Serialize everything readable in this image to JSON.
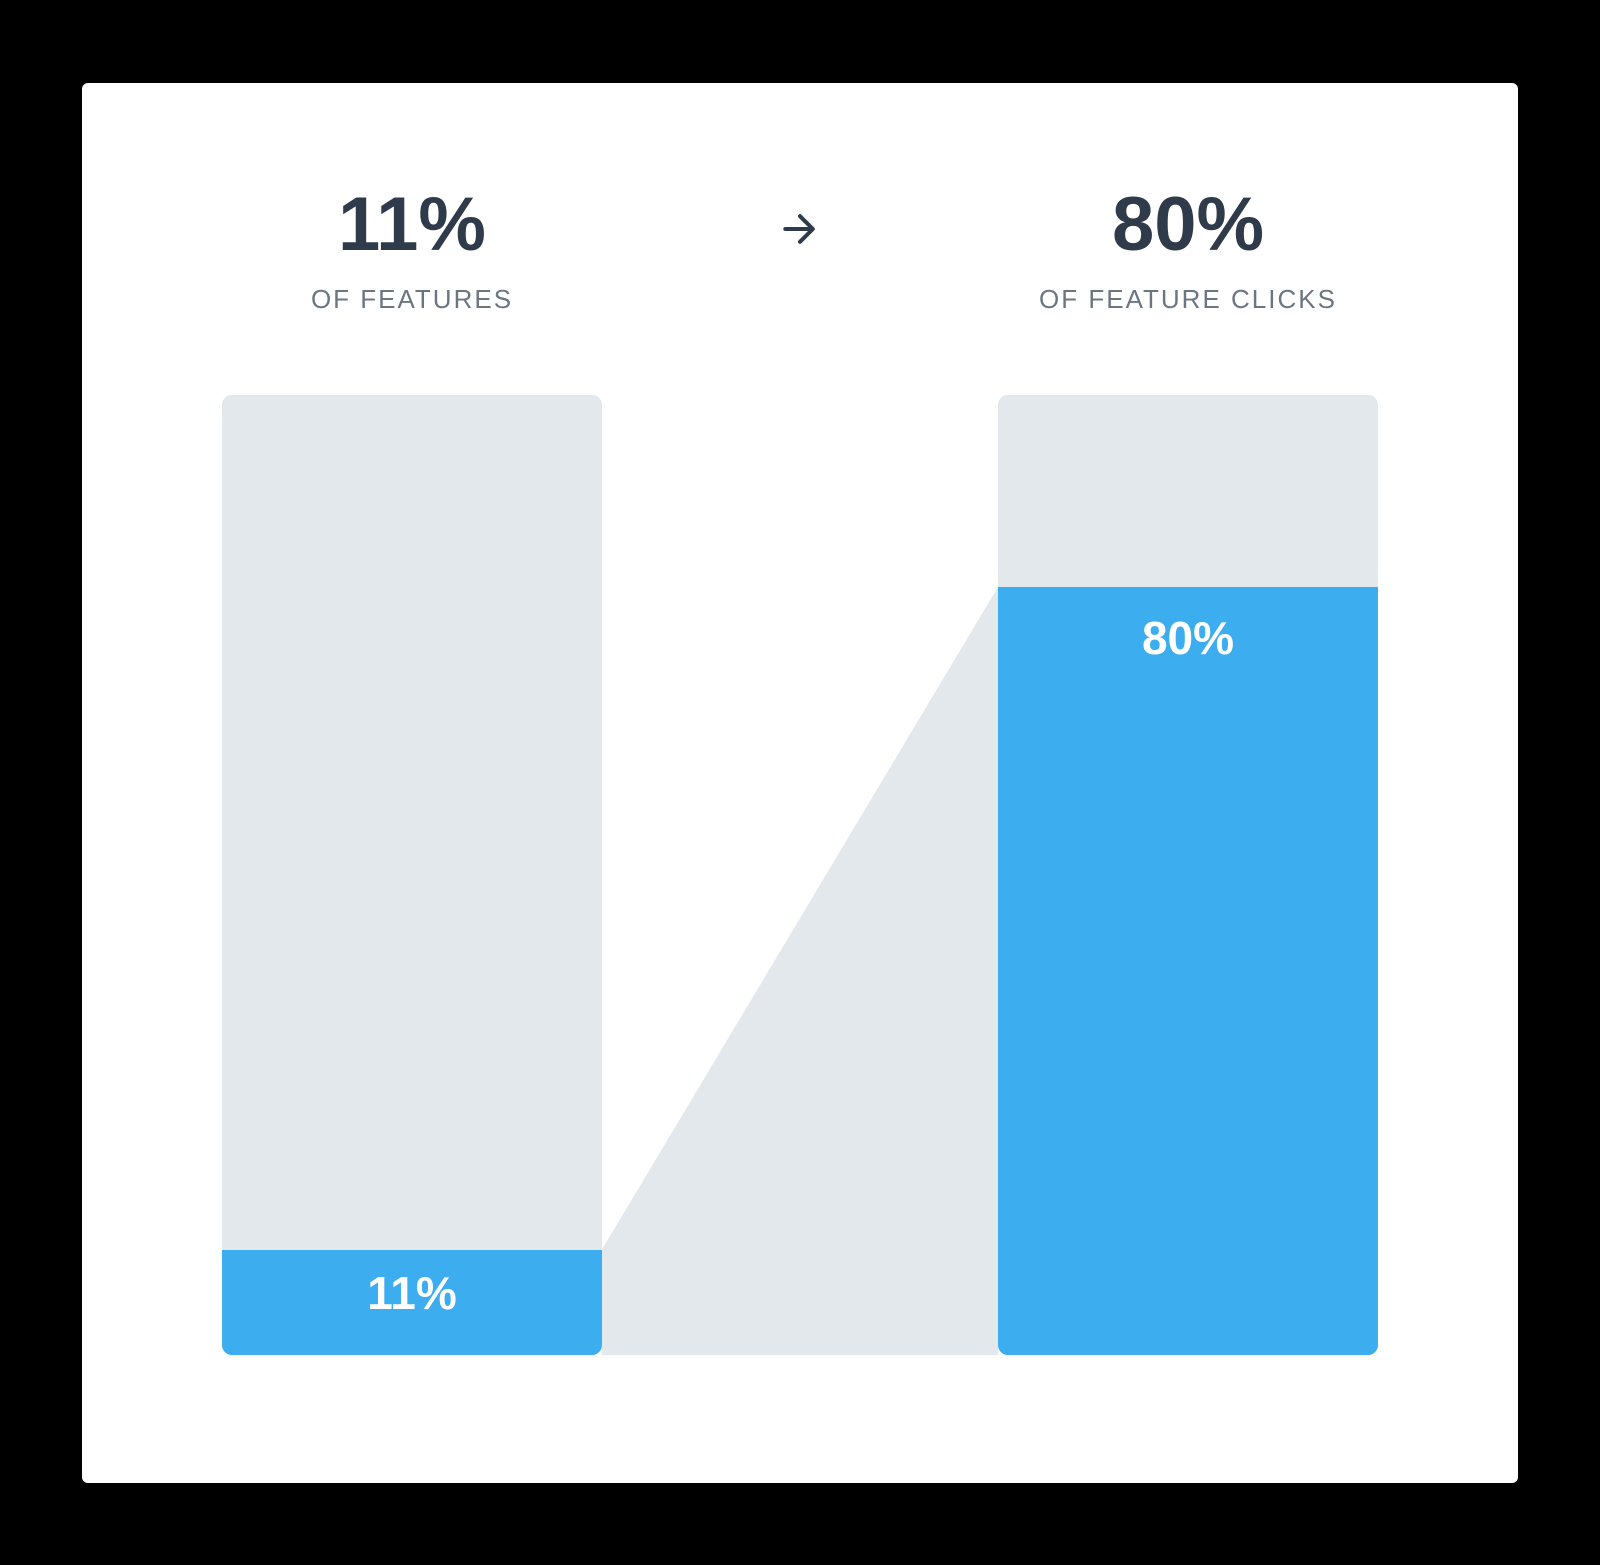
{
  "chart_data": {
    "type": "bar",
    "categories": [
      "OF FEATURES",
      "OF FEATURE CLICKS"
    ],
    "values": [
      11,
      80
    ],
    "ylim": [
      0,
      100
    ],
    "series": [
      {
        "name": "features",
        "header_value": "11%",
        "header_label": "OF FEATURES",
        "bar_label": "11%",
        "percent": 11
      },
      {
        "name": "feature-clicks",
        "header_value": "80%",
        "header_label": "OF FEATURE CLICKS",
        "bar_label": "80%",
        "percent": 80
      }
    ],
    "colors": {
      "text_dark": "#2f3b4a",
      "text_muted": "#6b7682",
      "bar_bg": "#e3e8ec",
      "bar_fill": "#3cadee"
    }
  }
}
